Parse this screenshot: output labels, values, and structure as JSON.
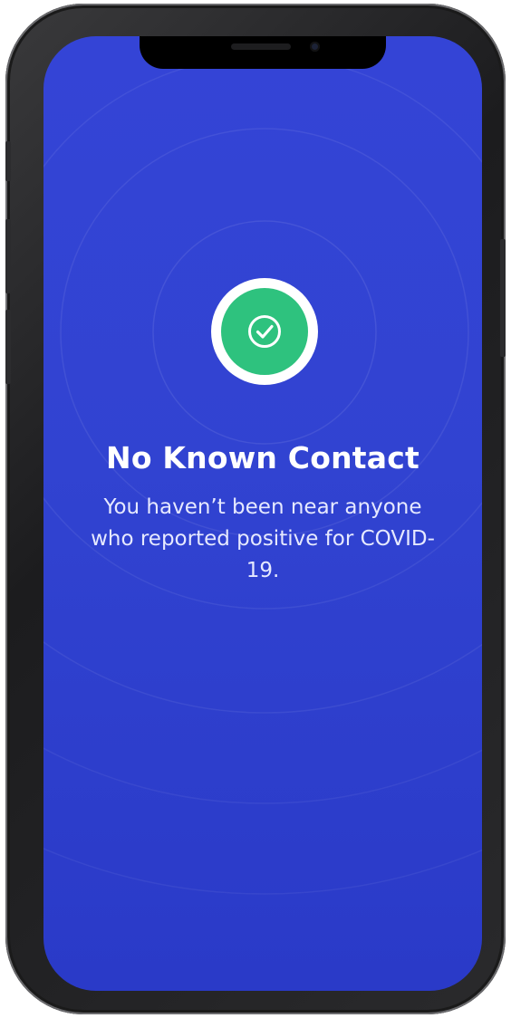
{
  "exposure_status": {
    "icon": "check-circle-icon",
    "title": "No Known Contact",
    "message": "You haven’t been near anyone who reported positive for COVID-19."
  },
  "colors": {
    "background": "#3143d1",
    "status_ok": "#2ec27e",
    "ring": "#ffffff",
    "text": "#ffffff"
  }
}
